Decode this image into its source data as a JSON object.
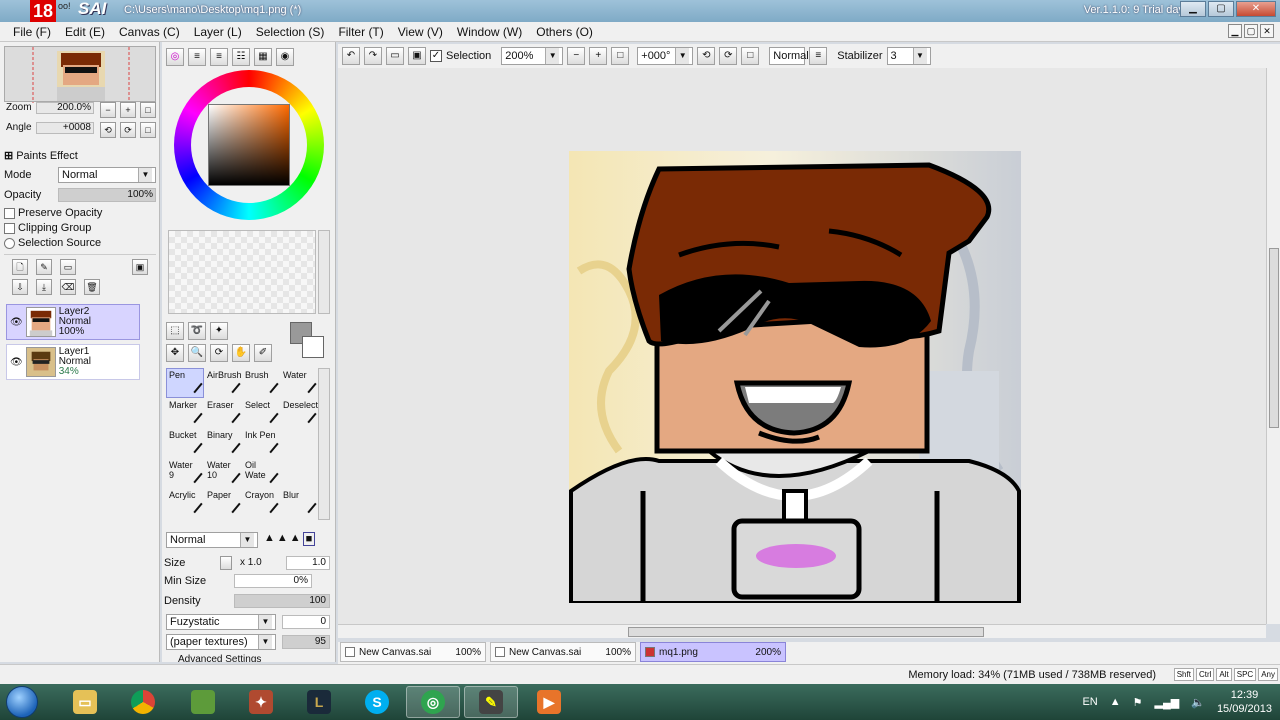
{
  "window": {
    "badge": "18",
    "logo": "oo!",
    "app_name": "SAI",
    "path": "C:\\Users\\mano\\Desktop\\mq1.png (*)",
    "version": "Ver.1.1.0: 9 Trial day"
  },
  "menu": [
    "File (F)",
    "Edit (E)",
    "Canvas (C)",
    "Layer (L)",
    "Selection (S)",
    "Filter (T)",
    "View (V)",
    "Window (W)",
    "Others (O)"
  ],
  "toolbar": {
    "selection_label": "Selection",
    "zoom": "200%",
    "angle": "+000°",
    "blend": "Normal",
    "stabilizer_label": "Stabilizer",
    "stabilizer_value": "3"
  },
  "navigator": {
    "zoom_label": "Zoom",
    "zoom_value": "200.0%",
    "angle_label": "Angle",
    "angle_value": "+0008"
  },
  "layer_props": {
    "paints_effect": "Paints Effect",
    "mode_label": "Mode",
    "mode_value": "Normal",
    "opacity_label": "Opacity",
    "opacity_value": "100%",
    "preserve_opacity": "Preserve Opacity",
    "clipping_group": "Clipping Group",
    "selection_source": "Selection Source"
  },
  "layers": [
    {
      "name": "Layer2",
      "mode": "Normal",
      "opacity": "100%"
    },
    {
      "name": "Layer1",
      "mode": "Normal",
      "opacity": "34%"
    }
  ],
  "tools": [
    {
      "name": "Pen",
      "size": ""
    },
    {
      "name": "AirBrush",
      "size": ""
    },
    {
      "name": "Brush",
      "size": ""
    },
    {
      "name": "Water",
      "size": ""
    },
    {
      "name": "Marker",
      "size": ""
    },
    {
      "name": "Eraser",
      "size": ""
    },
    {
      "name": "Select",
      "size": ""
    },
    {
      "name": "Deselect",
      "size": ""
    },
    {
      "name": "Bucket",
      "size": ""
    },
    {
      "name": "Binary",
      "size": ""
    },
    {
      "name": "Ink Pen",
      "size": ""
    },
    {
      "name": "",
      "size": ""
    },
    {
      "name": "Water",
      "size": "9"
    },
    {
      "name": "Water",
      "size": "10"
    },
    {
      "name": "Oil Wate",
      "size": ""
    },
    {
      "name": "",
      "size": ""
    },
    {
      "name": "Acrylic",
      "size": ""
    },
    {
      "name": "Paper",
      "size": ""
    },
    {
      "name": "Crayon",
      "size": ""
    },
    {
      "name": "Blur",
      "size": ""
    }
  ],
  "brush": {
    "mode": "Normal",
    "size_label": "Size",
    "size_mult": "x 1.0",
    "size_value": "1.0",
    "min_size_label": "Min Size",
    "min_size_value": "0%",
    "density_label": "Density",
    "density_value": "100",
    "texture1": "Fuzystatic",
    "texture1_value": "0",
    "texture2": "(paper textures)",
    "texture2_value": "95",
    "advanced": "Advanced Settings"
  },
  "documents": [
    {
      "name": "New Canvas.sai",
      "zoom": "100%",
      "active": false
    },
    {
      "name": "New Canvas.sai",
      "zoom": "100%",
      "active": false
    },
    {
      "name": "mq1.png",
      "zoom": "200%",
      "active": true
    }
  ],
  "status": {
    "memory": "Memory load: 34% (71MB used / 738MB reserved)",
    "keys": [
      "Shft",
      "Ctrl",
      "Alt",
      "SPC",
      "Any"
    ]
  },
  "taskbar": {
    "apps": [
      "explorer",
      "chrome",
      "minecraft",
      "game",
      "league",
      "skype",
      "browser",
      "paint-tool",
      "media"
    ],
    "tray_lang": "EN",
    "time": "12:39",
    "date": "15/09/2013"
  },
  "colors": {
    "hair": "#7a2a05",
    "skin": "#e4a882",
    "accent": "#c9c3ff"
  }
}
